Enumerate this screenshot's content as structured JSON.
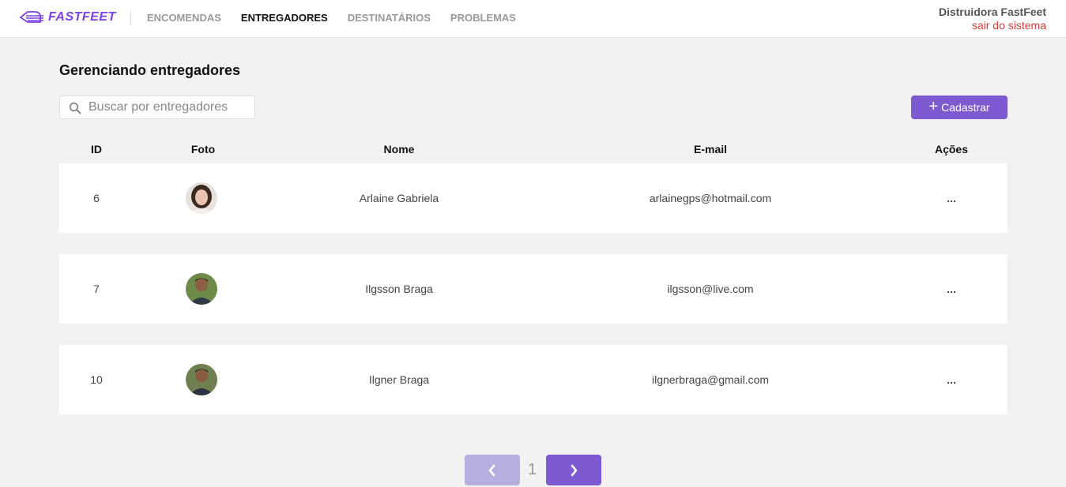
{
  "brand": {
    "name": "FASTFEET",
    "color": "#7d40e7"
  },
  "nav": [
    {
      "label": "ENCOMENDAS",
      "active": false
    },
    {
      "label": "ENTREGADORES",
      "active": true
    },
    {
      "label": "DESTINATÁRIOS",
      "active": false
    },
    {
      "label": "PROBLEMAS",
      "active": false
    }
  ],
  "user": {
    "name": "Distruidora FastFeet",
    "logout_label": "sair do sistema"
  },
  "page": {
    "title": "Gerenciando entregadores"
  },
  "search": {
    "placeholder": "Buscar por entregadores",
    "value": "",
    "icon": "search-icon"
  },
  "actions": {
    "add_label": "Cadastrar",
    "add_icon": "plus-icon",
    "accent_color": "#7d5ad1"
  },
  "table": {
    "columns": [
      "ID",
      "Foto",
      "Nome",
      "E-mail",
      "Ações"
    ],
    "rows": [
      {
        "id": "6",
        "name": "Arlaine Gabriela",
        "email": "arlainegps@hotmail.com",
        "actions": "...",
        "photo": "avatar-woman"
      },
      {
        "id": "7",
        "name": "Ilgsson Braga",
        "email": "ilgsson@live.com",
        "actions": "...",
        "photo": "avatar-man"
      },
      {
        "id": "10",
        "name": "Ilgner Braga",
        "email": "ilgnerbraga@gmail.com",
        "actions": "...",
        "photo": "avatar-man"
      }
    ]
  },
  "pagination": {
    "current_page": "1",
    "prev_icon": "chevron-left-icon",
    "next_icon": "chevron-right-icon"
  }
}
